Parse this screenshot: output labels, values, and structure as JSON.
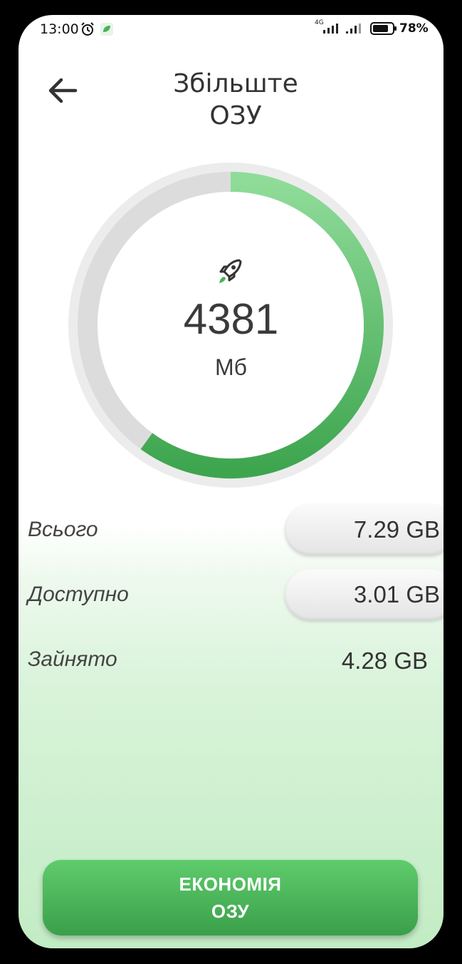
{
  "status_bar": {
    "time": "13:00",
    "network": "4G",
    "battery": "78%"
  },
  "header": {
    "title_line1": "Збільште",
    "title_line2": "ОЗУ"
  },
  "gauge": {
    "value": "4381",
    "unit": "Мб",
    "fill_fraction": 0.6,
    "track_color": "#e6e6e6",
    "fill_color": "#4cb25b"
  },
  "stats": [
    {
      "label": "Всього",
      "value": "7.29 GB"
    },
    {
      "label": "Доступно",
      "value": "3.01 GB"
    },
    {
      "label": "Зайнято",
      "value": "4.28 GB"
    }
  ],
  "cta": {
    "line1": "ЕКОНОМІЯ",
    "line2": "ОЗУ"
  },
  "icons": [
    "back-arrow-icon",
    "rocket-icon",
    "alarm-icon",
    "leaf-icon",
    "signal-icon",
    "battery-icon"
  ]
}
